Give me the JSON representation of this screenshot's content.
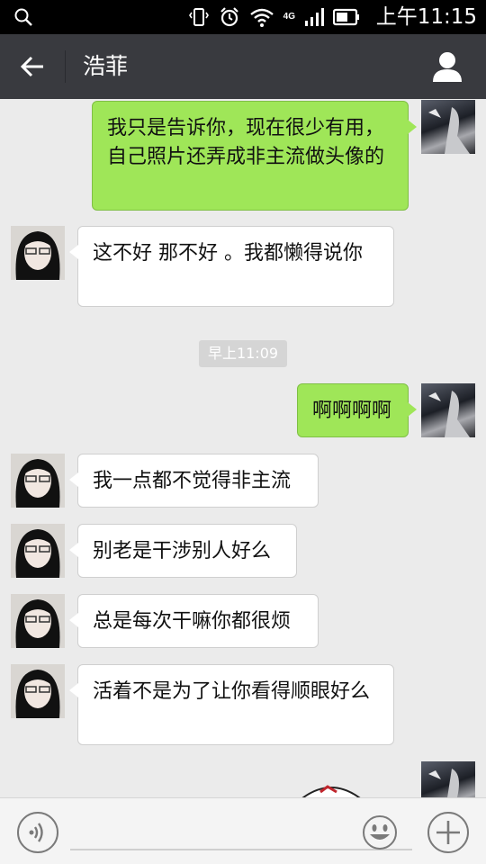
{
  "status_bar": {
    "time": "上午11:15",
    "network": "4G",
    "icons": [
      "search-icon",
      "vibrate-icon",
      "alarm-icon",
      "wifi-icon",
      "signal-icon",
      "battery-icon"
    ]
  },
  "header": {
    "title": "浩菲",
    "back_icon": "arrow-left-icon",
    "profile_icon": "person-icon"
  },
  "messages": [
    {
      "from": "me",
      "text": "我只是告诉你，现在很少有用，自己照片还弄成非主流做头像的"
    },
    {
      "from": "her",
      "text": "这不好  那不好  。我都懒得说你"
    },
    {
      "type": "timestamp",
      "text": "早上11:09"
    },
    {
      "from": "me",
      "text": "啊啊啊啊"
    },
    {
      "from": "her",
      "text": "我一点都不觉得非主流"
    },
    {
      "from": "her",
      "text": "别老是干涉别人好么"
    },
    {
      "from": "her",
      "text": "总是每次干嘛你都很烦"
    },
    {
      "from": "her",
      "text": "活着不是为了让你看得顺眼好么"
    }
  ],
  "input_bar": {
    "voice_icon": "voice-icon",
    "emoji_icon": "smiley-icon",
    "more_icon": "plus-icon",
    "placeholder": ""
  },
  "colors": {
    "sent_bubble": "#9fe658",
    "received_bubble": "#ffffff",
    "header_bg": "#393a3f",
    "chat_bg": "#ebebeb"
  }
}
